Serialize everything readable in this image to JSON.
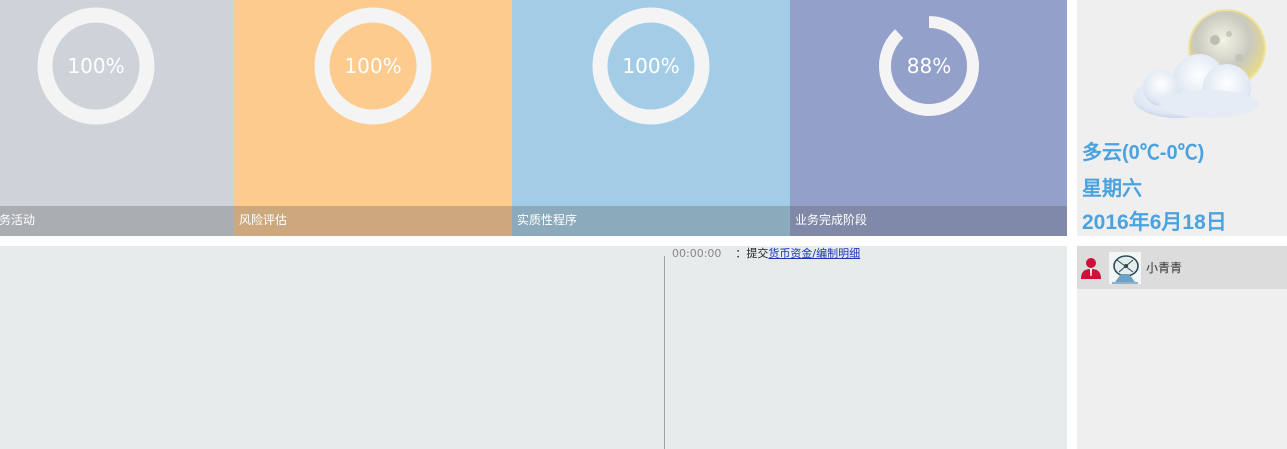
{
  "tiles": [
    {
      "percent": 100,
      "percent_label": "100%",
      "caption": "务活动",
      "color": "#cdd3d9"
    },
    {
      "percent": 100,
      "percent_label": "100%",
      "caption": "风险评估",
      "color": "#fdcb8e"
    },
    {
      "percent": 100,
      "percent_label": "100%",
      "caption": "实质性程序",
      "color": "#a3cde6"
    },
    {
      "percent": 88,
      "percent_label": "88%",
      "caption": "业务完成阶段",
      "color": "#93a0c9"
    }
  ],
  "weather": {
    "condition": "多云(0℃-0℃)",
    "weekday": "星期六",
    "date": "2016年6月18日",
    "icon": "cloudy-moon-icon"
  },
  "log": {
    "time": "00:00:00",
    "separator": "：",
    "action": "提交",
    "link_text": "货币资金/编制明细"
  },
  "user": {
    "name": "小青青",
    "icon": "user-icon",
    "avatar_icon": "satellite-dish-avatar"
  }
}
